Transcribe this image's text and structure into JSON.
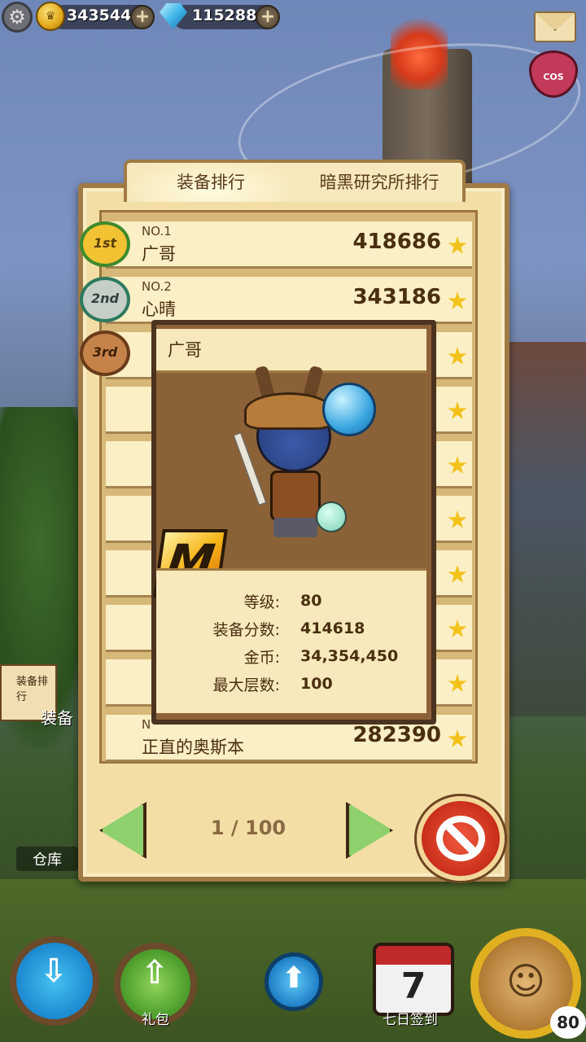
{
  "resources": {
    "gold": "34354450",
    "gems": "115288",
    "cos_label": "COS"
  },
  "tabs": [
    {
      "label": "装备排行",
      "active": true
    },
    {
      "label": "暗黑研究所排行",
      "active": false
    }
  ],
  "medals": [
    "1st",
    "2nd",
    "3rd"
  ],
  "ranking": [
    {
      "no": "NO.1",
      "name": "广哥",
      "score": "418686"
    },
    {
      "no": "NO.2",
      "name": "心晴",
      "score": "343186"
    },
    {
      "no": "N",
      "name": "正直的奥斯本",
      "score": "282390"
    }
  ],
  "popup": {
    "name": "广哥",
    "badge": "M",
    "stats": [
      {
        "label": "等级:",
        "value": "80"
      },
      {
        "label": "装备分数:",
        "value": "414618"
      },
      {
        "label": "金币:",
        "value": "34,354,450"
      },
      {
        "label": "最大层数:",
        "value": "100"
      }
    ]
  },
  "pagination": {
    "indicator": "1 / 100"
  },
  "side": {
    "rank_sign": "装备排行",
    "rank_short": "装备",
    "warehouse": "仓库"
  },
  "bottom": {
    "gift": "礼包",
    "checkin": "七日签到",
    "checkin_day": "7",
    "level": "80"
  },
  "colors": {
    "parchment": "#f3dfa6",
    "wood_border": "#a07a45",
    "text_brown": "#4a2e10",
    "star_gold": "#f3c21a",
    "close_red": "#d6361f"
  }
}
